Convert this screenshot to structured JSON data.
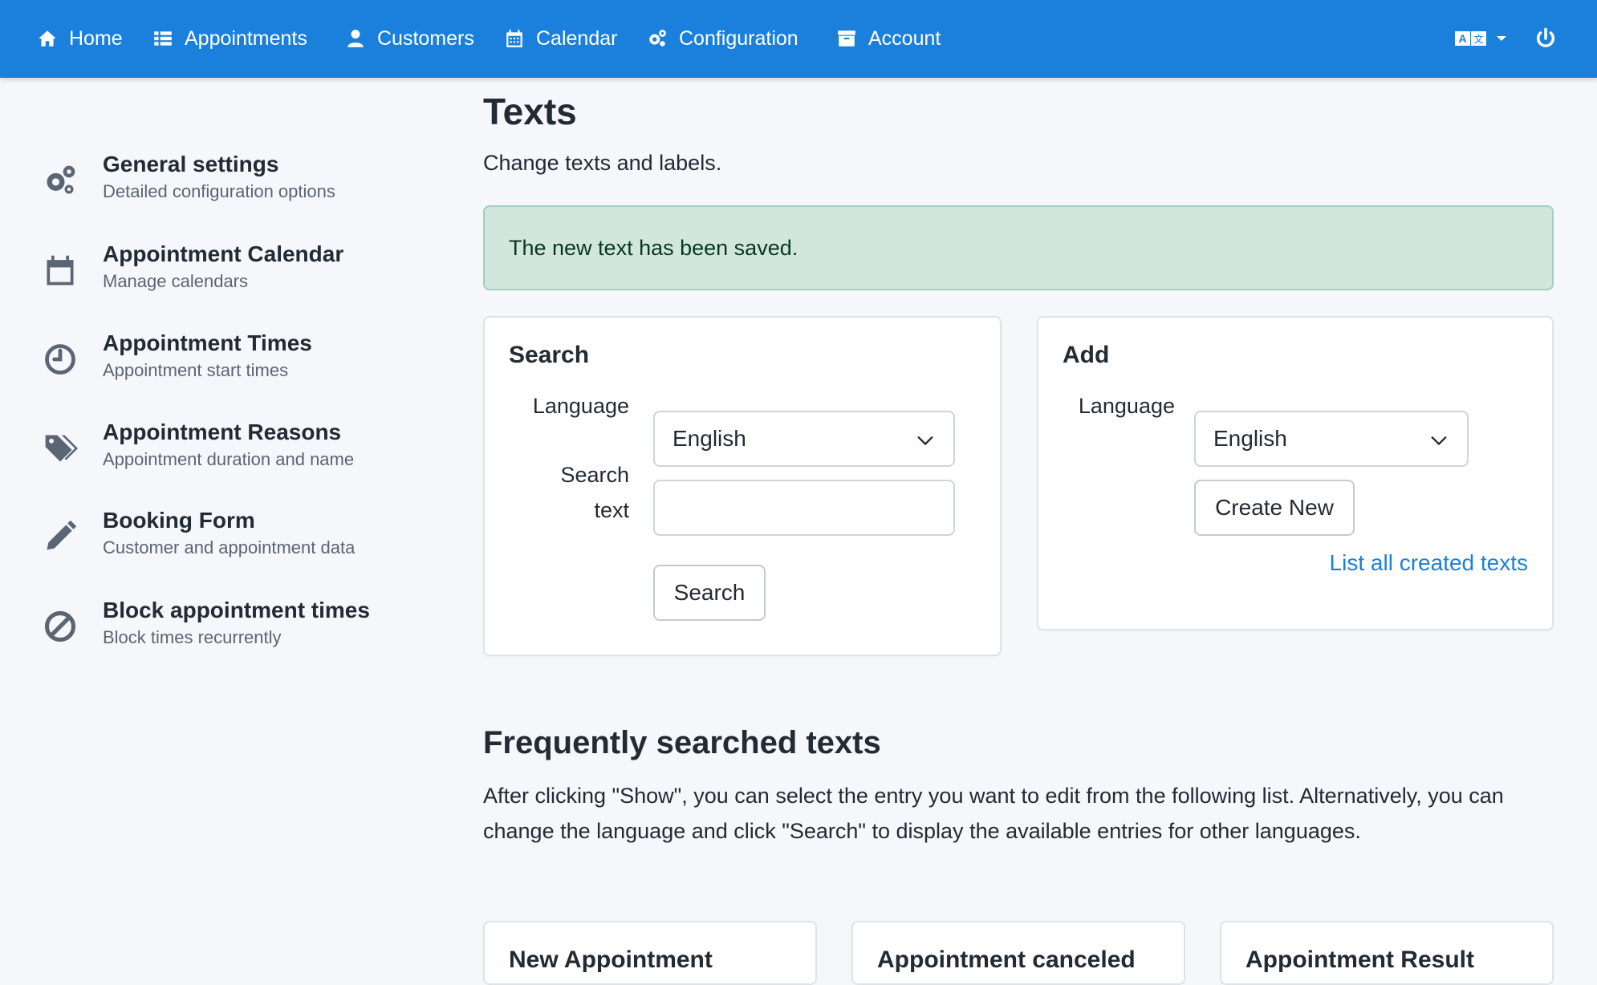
{
  "nav": {
    "home": "Home",
    "appointments": "Appointments",
    "customers": "Customers",
    "calendar": "Calendar",
    "configuration": "Configuration",
    "account": "Account"
  },
  "sidebar": {
    "items": [
      {
        "title": "General settings",
        "subtitle": "Detailed configuration options",
        "icon": "gears-icon"
      },
      {
        "title": "Appointment Calendar",
        "subtitle": "Manage calendars",
        "icon": "calendar-icon"
      },
      {
        "title": "Appointment Times",
        "subtitle": "Appointment start times",
        "icon": "clock-icon"
      },
      {
        "title": "Appointment Reasons",
        "subtitle": "Appointment duration and name",
        "icon": "tags-icon"
      },
      {
        "title": "Booking Form",
        "subtitle": "Customer and appointment data",
        "icon": "pencil-icon"
      },
      {
        "title": "Block appointment times",
        "subtitle": "Block times recurrently",
        "icon": "ban-icon"
      }
    ]
  },
  "page": {
    "title": "Texts",
    "description": "Change texts and labels.",
    "alert": "The new text has been saved."
  },
  "search_card": {
    "title": "Search",
    "language_label": "Language",
    "language_value": "English",
    "search_text_label_line1": "Search",
    "search_text_label_line2": "text",
    "search_text_value": "",
    "search_button": "Search"
  },
  "add_card": {
    "title": "Add",
    "language_label": "Language",
    "language_value": "English",
    "create_button": "Create New",
    "list_link": "List all created texts"
  },
  "frequent": {
    "title": "Frequently searched texts",
    "description": "After clicking \"Show\", you can select the entry you want to edit from the following list. Alternatively, you can change the language and click \"Search\" to display the available entries for other languages.",
    "cards": [
      "New Appointment",
      "Appointment canceled",
      "Appointment Result"
    ]
  },
  "colors": {
    "navbar": "#1b80db",
    "success_bg": "#d1e7dd",
    "link": "#1b80db"
  }
}
